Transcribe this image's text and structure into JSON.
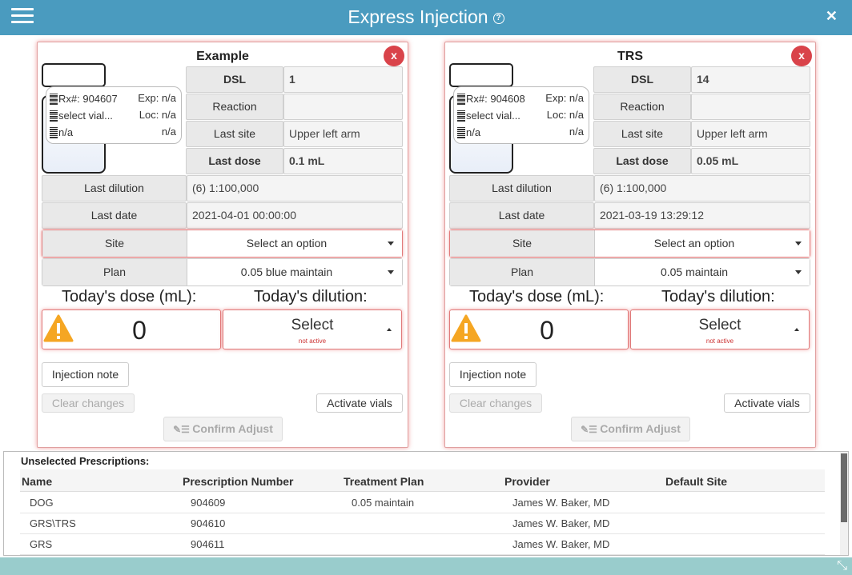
{
  "header": {
    "title": "Express Injection",
    "help_icon": "?",
    "close_icon": "✕"
  },
  "panels": [
    {
      "name": "Example",
      "remove_label": "x",
      "vial": {
        "rx": "Rx#: 904607",
        "exp": "Exp: n/a",
        "select": "select vial...",
        "loc": "Loc: n/a",
        "line3_left": "n/a",
        "line3_right": "n/a"
      },
      "dsl_label": "DSL",
      "dsl_value": "1",
      "reaction_label": "Reaction",
      "reaction_value": "",
      "last_site_label": "Last site",
      "last_site_value": "Upper left arm",
      "last_dose_label": "Last dose",
      "last_dose_value": "0.1 mL",
      "last_dilution_label": "Last dilution",
      "last_dilution_value": "(6) 1:100,000",
      "last_date_label": "Last date",
      "last_date_value": "2021-04-01 00:00:00",
      "site_label": "Site",
      "site_value": "Select an option",
      "plan_label": "Plan",
      "plan_value": "0.05 blue maintain",
      "todays_dose_label": "Today's dose (mL):",
      "todays_dilution_label": "Today's dilution:",
      "dose_value": "0",
      "dilution_value": "Select",
      "dilution_sub": "not active",
      "injection_note": "Injection note",
      "clear_changes": "Clear changes",
      "activate_vials": "Activate vials",
      "confirm_adjust": "Confirm Adjust"
    },
    {
      "name": "TRS",
      "remove_label": "x",
      "vial": {
        "rx": "Rx#: 904608",
        "exp": "Exp: n/a",
        "select": "select vial...",
        "loc": "Loc: n/a",
        "line3_left": "n/a",
        "line3_right": "n/a"
      },
      "dsl_label": "DSL",
      "dsl_value": "14",
      "reaction_label": "Reaction",
      "reaction_value": "",
      "last_site_label": "Last site",
      "last_site_value": "Upper left arm",
      "last_dose_label": "Last dose",
      "last_dose_value": "0.05 mL",
      "last_dilution_label": "Last dilution",
      "last_dilution_value": "(6) 1:100,000",
      "last_date_label": "Last date",
      "last_date_value": "2021-03-19 13:29:12",
      "site_label": "Site",
      "site_value": "Select an option",
      "plan_label": "Plan",
      "plan_value": "0.05 maintain",
      "todays_dose_label": "Today's dose (mL):",
      "todays_dilution_label": "Today's dilution:",
      "dose_value": "0",
      "dilution_value": "Select",
      "dilution_sub": "not active",
      "injection_note": "Injection note",
      "clear_changes": "Clear changes",
      "activate_vials": "Activate vials",
      "confirm_adjust": "Confirm Adjust"
    }
  ],
  "unselected": {
    "title": "Unselected Prescriptions:",
    "columns": [
      "Name",
      "Prescription Number",
      "Treatment Plan",
      "Provider",
      "Default Site"
    ],
    "rows": [
      {
        "name": "DOG",
        "number": "904609",
        "plan": "0.05 maintain",
        "provider": "James W. Baker, MD",
        "site": ""
      },
      {
        "name": "GRS\\TRS",
        "number": "904610",
        "plan": "",
        "provider": "James W. Baker, MD",
        "site": ""
      },
      {
        "name": "GRS",
        "number": "904611",
        "plan": "",
        "provider": "James W. Baker, MD",
        "site": ""
      }
    ]
  },
  "colors": {
    "header": "#4a9bbf",
    "alert_border": "#e07a7a",
    "remove_button": "#d9434a",
    "warning": "#f5a623",
    "statusbar": "#99cccc"
  },
  "icons": [
    "menu-icon",
    "help-icon",
    "close-icon",
    "remove-icon",
    "barcode-icon",
    "warning-icon",
    "syringe-icon",
    "resize-icon",
    "chevron-down-icon"
  ]
}
